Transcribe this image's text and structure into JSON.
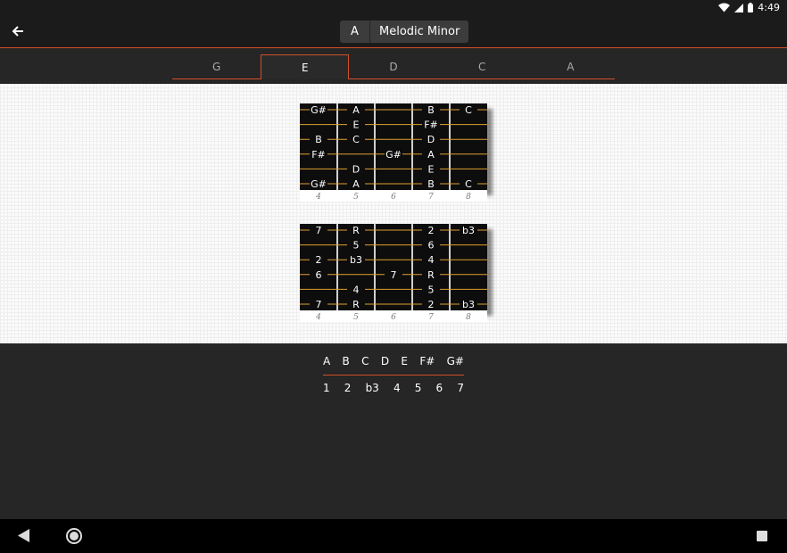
{
  "status_bar": {
    "time": "4:49",
    "icons": [
      "wifi-icon",
      "signal-icon",
      "battery-icon"
    ]
  },
  "toolbar": {
    "back_icon": "arrow-left-icon",
    "key": "A",
    "scale": "Melodic Minor"
  },
  "tabs": [
    {
      "label": "G",
      "active": false
    },
    {
      "label": "E",
      "active": true
    },
    {
      "label": "D",
      "active": false
    },
    {
      "label": "C",
      "active": false
    },
    {
      "label": "A",
      "active": false
    }
  ],
  "fretboards": {
    "fret_numbers": [
      "4",
      "5",
      "6",
      "7",
      "8"
    ],
    "notes_board": [
      [
        "G#",
        "A",
        "",
        "B",
        "C"
      ],
      [
        "",
        "E",
        "",
        "F#",
        ""
      ],
      [
        "B",
        "C",
        "",
        "D",
        ""
      ],
      [
        "F#",
        "",
        "G#",
        "A",
        ""
      ],
      [
        "",
        "D",
        "",
        "E",
        ""
      ],
      [
        "G#",
        "A",
        "",
        "B",
        "C"
      ]
    ],
    "intervals_board": [
      [
        "7",
        "R",
        "",
        "2",
        "b3"
      ],
      [
        "",
        "5",
        "",
        "6",
        ""
      ],
      [
        "2",
        "b3",
        "",
        "4",
        ""
      ],
      [
        "6",
        "",
        "7",
        "R",
        ""
      ],
      [
        "",
        "4",
        "",
        "5",
        ""
      ],
      [
        "7",
        "R",
        "",
        "2",
        "b3"
      ]
    ]
  },
  "summary": {
    "notes": [
      "A",
      "B",
      "C",
      "D",
      "E",
      "F#",
      "G#"
    ],
    "intervals": [
      "1",
      "2",
      "b3",
      "4",
      "5",
      "6",
      "7"
    ]
  },
  "colors": {
    "accent": "#d0502a",
    "string": "#e0a030",
    "board": "#0d0d0d"
  },
  "nav_bar": {
    "icons": [
      "nav-back-icon",
      "nav-home-icon",
      "nav-recents-icon"
    ]
  }
}
